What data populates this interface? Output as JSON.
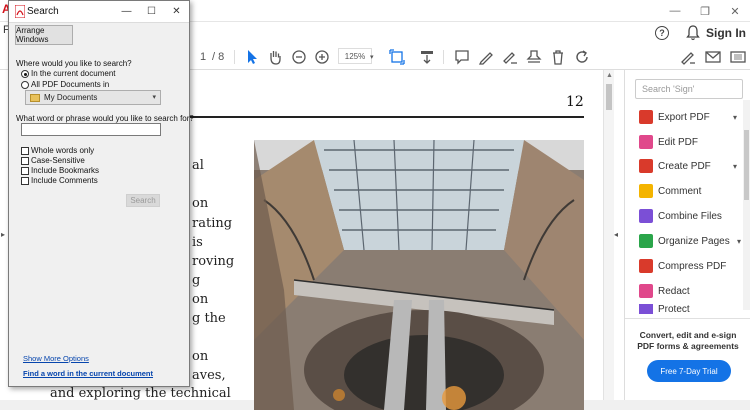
{
  "app": {
    "help_label": "?",
    "sign_in": "Sign In",
    "file_menu_fragment": "Fi",
    "app_icon_letter": "A"
  },
  "toolbar": {
    "page_input": "1",
    "page_total": "/ 8",
    "zoom": "125%"
  },
  "document": {
    "page_number": "12",
    "text_lines": [
      "al",
      "on",
      "rating",
      "is",
      "roving",
      "g",
      "on",
      "g the",
      "on",
      "aves,",
      "and exploring the technical"
    ]
  },
  "tools": {
    "search_placeholder": "Search 'Sign'",
    "items": [
      {
        "label": "Export PDF",
        "color": "#d93a2b",
        "has_chevron": true
      },
      {
        "label": "Edit PDF",
        "color": "#e0488b",
        "has_chevron": false
      },
      {
        "label": "Create PDF",
        "color": "#d93a2b",
        "has_chevron": true
      },
      {
        "label": "Comment",
        "color": "#f4b400",
        "has_chevron": false
      },
      {
        "label": "Combine Files",
        "color": "#7b4fd6",
        "has_chevron": false
      },
      {
        "label": "Organize Pages",
        "color": "#2aa54a",
        "has_chevron": true
      },
      {
        "label": "Compress PDF",
        "color": "#d93a2b",
        "has_chevron": false
      },
      {
        "label": "Redact",
        "color": "#e0488b",
        "has_chevron": false
      },
      {
        "label": "Protect",
        "color": "#7b4fd6",
        "has_chevron": false
      }
    ],
    "promo_text": "Convert, edit and e-sign PDF forms & agreements",
    "trial_button": "Free 7-Day Trial"
  },
  "search_dialog": {
    "title": "Search",
    "arrange_button": "Arrange Windows",
    "where_label": "Where would you like to search?",
    "option_current": "In the current document",
    "option_all": "All PDF Documents in",
    "location_value": "My Documents",
    "what_label": "What word or phrase would you like to search for?",
    "search_value": "",
    "check_whole": "Whole words only",
    "check_case": "Case-Sensitive",
    "check_bookmarks": "Include Bookmarks",
    "check_comments": "Include Comments",
    "search_button": "Search",
    "more_options": "Show More Options",
    "find_word": "Find a word in the current document"
  }
}
